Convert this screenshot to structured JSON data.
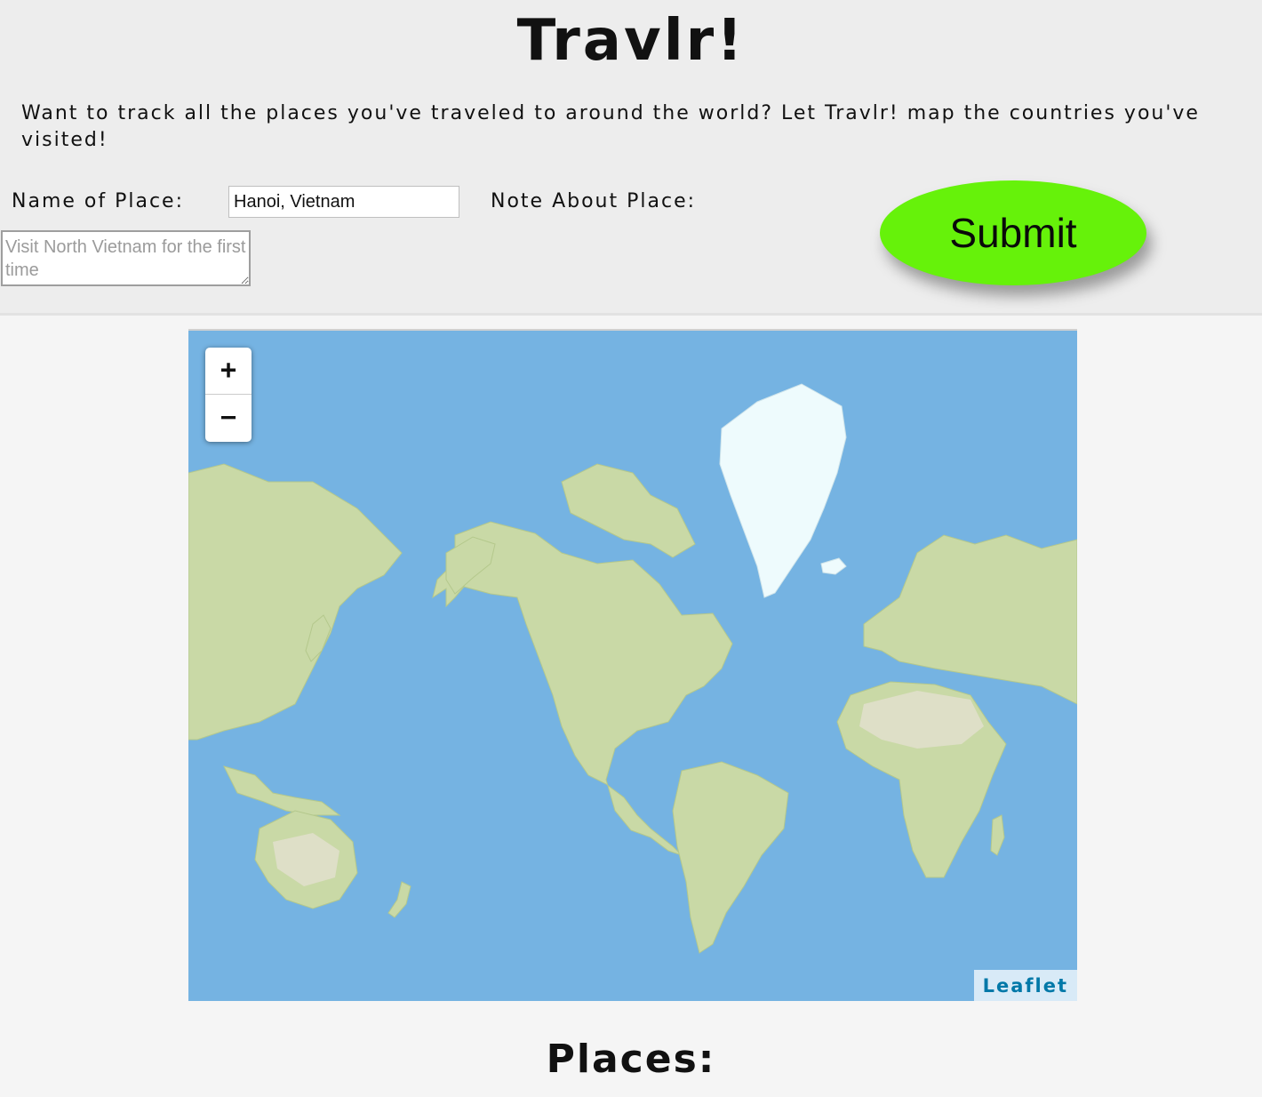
{
  "header": {
    "title": "Travlr!",
    "intro": "Want to track all the places you've traveled to around the world? Let Travlr! map the countries you've visited!"
  },
  "form": {
    "name_label": "Name of Place:",
    "name_value": "Hanoi, Vietnam",
    "note_label": "Note About Place:",
    "note_placeholder": "Visit North Vietnam for the first time",
    "submit_label": "Submit"
  },
  "map": {
    "zoom_in_label": "+",
    "zoom_out_label": "−",
    "attribution": "Leaflet",
    "ocean_color": "#75b3e2",
    "land_color": "#c9d9a6",
    "ice_color": "#eefbfd"
  },
  "places": {
    "heading": "Places:"
  }
}
